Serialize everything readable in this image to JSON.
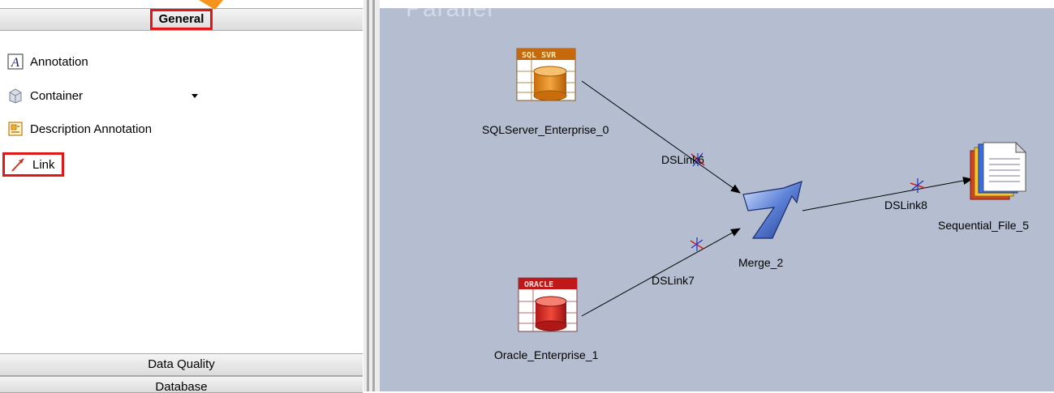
{
  "palette": {
    "general_header": "General",
    "items": [
      {
        "label": "Annotation",
        "icon": "annotation-icon"
      },
      {
        "label": "Container",
        "icon": "container-icon"
      },
      {
        "label": "Description Annotation",
        "icon": "description-annotation-icon"
      },
      {
        "label": "Link",
        "icon": "link-icon"
      }
    ],
    "data_quality_header": "Data Quality",
    "database_header": "Database"
  },
  "canvas": {
    "title": "Parallel",
    "stages": [
      {
        "name": "SQLServer_Enterprise_0",
        "icon": "sql-server-icon",
        "badge": "SQL SVR"
      },
      {
        "name": "Oracle_Enterprise_1",
        "icon": "oracle-icon",
        "badge": "ORACLE"
      },
      {
        "name": "Merge_2",
        "icon": "merge-icon"
      },
      {
        "name": "Sequential_File_5",
        "icon": "sequential-file-icon"
      }
    ],
    "links": [
      {
        "name": "DSLink6"
      },
      {
        "name": "DSLink7"
      },
      {
        "name": "DSLink8"
      }
    ]
  },
  "colors": {
    "canvas_bg": "#b4bed0",
    "highlight": "#e01818",
    "banner": "#f7941d"
  }
}
